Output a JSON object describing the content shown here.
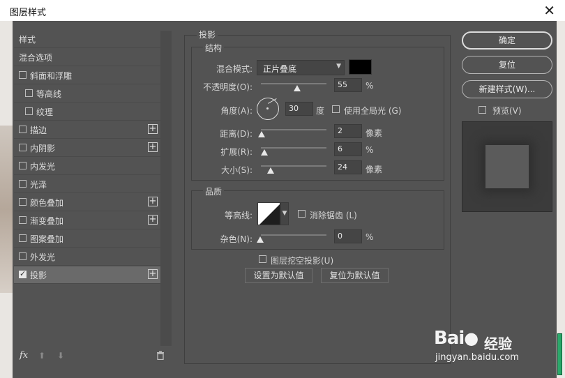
{
  "window": {
    "title": "图层样式",
    "close_glyph": "✕"
  },
  "left_panel": {
    "header": "样式",
    "items": [
      {
        "label": "混合选项",
        "has_checkbox": false,
        "checked": false,
        "has_plus": false,
        "indent": 0
      },
      {
        "label": "斜面和浮雕",
        "has_checkbox": true,
        "checked": false,
        "has_plus": false,
        "indent": 0
      },
      {
        "label": "等高线",
        "has_checkbox": true,
        "checked": false,
        "has_plus": false,
        "indent": 1
      },
      {
        "label": "纹理",
        "has_checkbox": true,
        "checked": false,
        "has_plus": false,
        "indent": 1
      },
      {
        "label": "描边",
        "has_checkbox": true,
        "checked": false,
        "has_plus": true,
        "indent": 0
      },
      {
        "label": "内阴影",
        "has_checkbox": true,
        "checked": false,
        "has_plus": true,
        "indent": 0
      },
      {
        "label": "内发光",
        "has_checkbox": true,
        "checked": false,
        "has_plus": false,
        "indent": 0
      },
      {
        "label": "光泽",
        "has_checkbox": true,
        "checked": false,
        "has_plus": false,
        "indent": 0
      },
      {
        "label": "颜色叠加",
        "has_checkbox": true,
        "checked": false,
        "has_plus": true,
        "indent": 0
      },
      {
        "label": "渐变叠加",
        "has_checkbox": true,
        "checked": false,
        "has_plus": true,
        "indent": 0
      },
      {
        "label": "图案叠加",
        "has_checkbox": true,
        "checked": false,
        "has_plus": false,
        "indent": 0
      },
      {
        "label": "外发光",
        "has_checkbox": true,
        "checked": false,
        "has_plus": false,
        "indent": 0
      },
      {
        "label": "投影",
        "has_checkbox": true,
        "checked": true,
        "has_plus": true,
        "indent": 0,
        "selected": true
      }
    ],
    "plus_glyph": "+",
    "footer": {
      "fx": "fx",
      "up": "⬆",
      "down": "⬇",
      "trash": "🗑"
    }
  },
  "drop_shadow": {
    "section_title": "投影",
    "structure": {
      "title": "结构",
      "blend_mode_label": "混合模式:",
      "blend_mode_value": "正片叠底",
      "shadow_color": "#000000",
      "opacity_label": "不透明度(O):",
      "opacity_value": "55",
      "opacity_unit": "%",
      "opacity_fraction": 0.55,
      "angle_label": "角度(A):",
      "angle_value": "30",
      "angle_unit": "度",
      "global_light_label": "使用全局光 (G)",
      "global_light_checked": true,
      "distance_label": "距离(D):",
      "distance_value": "2",
      "distance_unit": "像素",
      "spread_label": "扩展(R):",
      "spread_value": "6",
      "spread_unit": "%",
      "size_label": "大小(S):",
      "size_value": "24",
      "size_unit": "像素"
    },
    "quality": {
      "title": "品质",
      "contour_label": "等高线:",
      "antialias_label": "消除锯齿 (L)",
      "antialias_checked": false,
      "noise_label": "杂色(N):",
      "noise_value": "0",
      "noise_unit": "%"
    },
    "knockout_label": "图层挖空投影(U)",
    "knockout_checked": true,
    "make_default_label": "设置为默认值",
    "reset_default_label": "复位为默认值"
  },
  "right_panel": {
    "ok_label": "确定",
    "reset_label": "复位",
    "new_style_label": "新建样式(W)...",
    "preview_label": "预览(V)",
    "preview_checked": true
  },
  "watermark": {
    "line1": "Bai",
    "line1b": "经验",
    "line2": "jingyan.baidu.com"
  }
}
